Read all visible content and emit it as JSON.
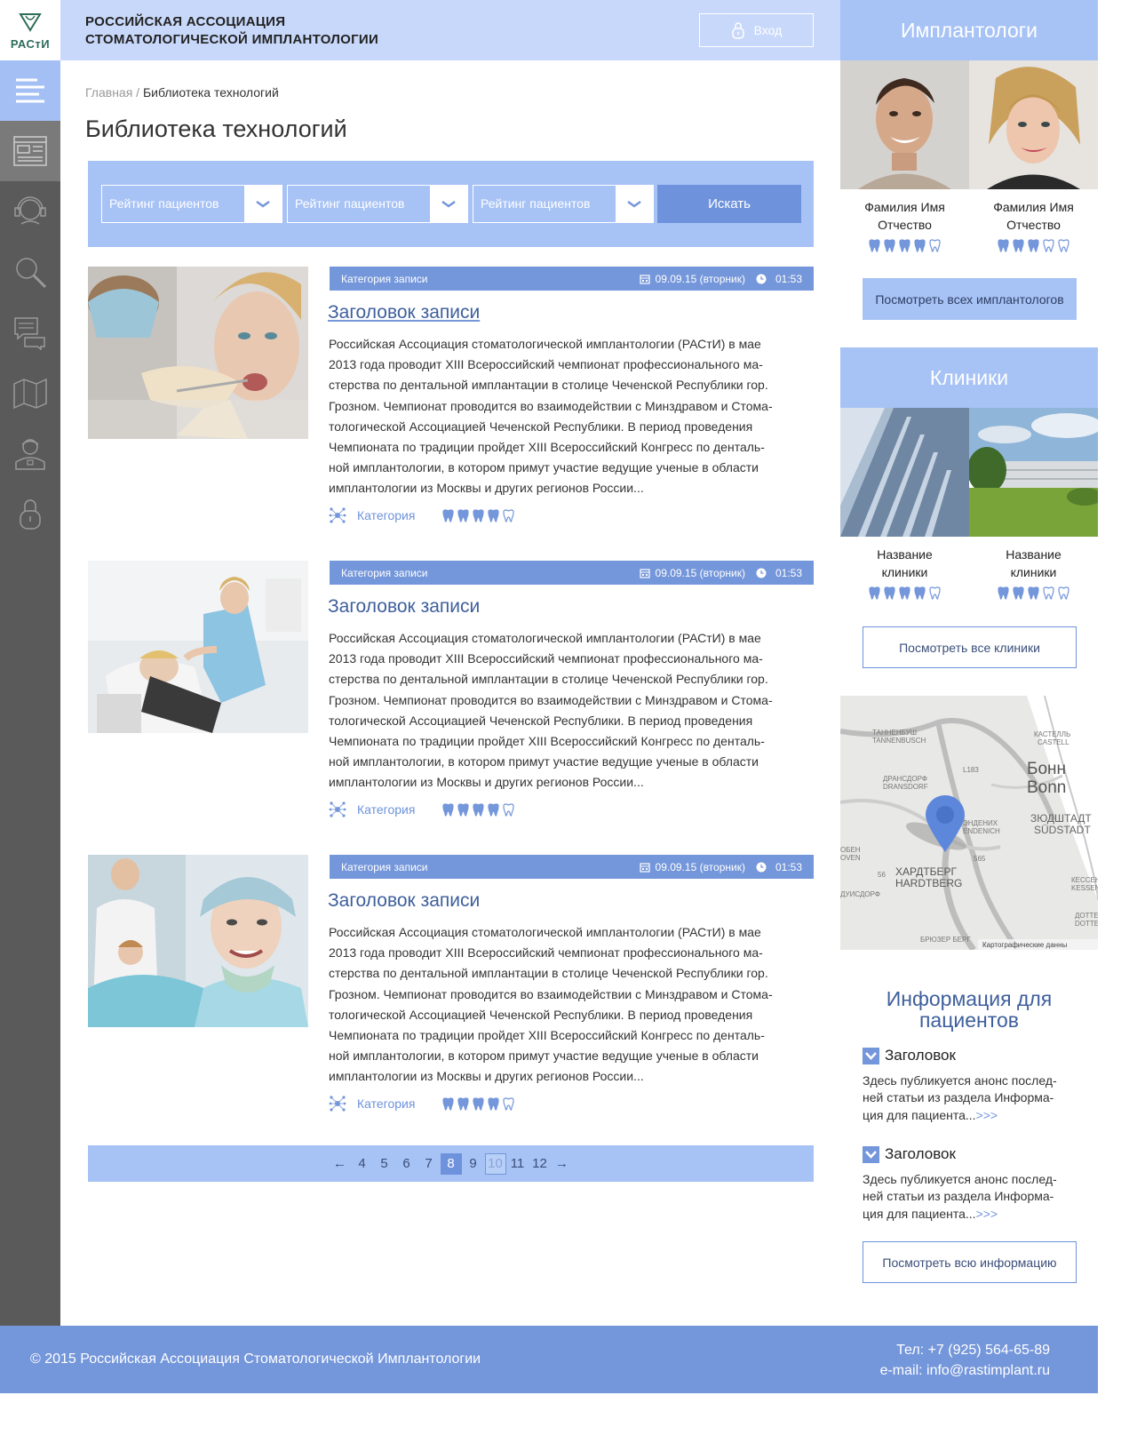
{
  "header": {
    "logo_text": "РАСтИ",
    "org_line1": "Российская Ассоциация",
    "org_line2": "Стоматологической Имплантологии",
    "login_label": "Вход"
  },
  "sidebar": {
    "items": [
      "menu-icon",
      "library-icon",
      "support-icon",
      "search-icon",
      "chat-icon",
      "map-icon",
      "doctor-icon",
      "lock-icon"
    ]
  },
  "breadcrumb": {
    "home": "Главная",
    "sep": " / ",
    "current": "Библиотека технологий"
  },
  "page_title": "Библиотека технологий",
  "filters": {
    "select1": "Рейтинг пациентов",
    "select2": "Рейтинг пациентов",
    "select3": "Рейтинг пациентов",
    "search_label": "Искать"
  },
  "posts": [
    {
      "category": "Категория записи",
      "date": "09.09.15 (вторник)",
      "time": "01:53",
      "title": "Заголовок записи",
      "lines": [
        "Российская Ассоциация стоматологической имплантологии (РАСтИ) в мае",
        "2013 года проводит XIII Всероссийский чемпионат профессионального ма-",
        "стерства по дентальной имплантации в столице Чеченской Республики гор.",
        "Грозном. Чемпионат проводится во взаимодействии с Минздравом и Стома-",
        "тологической Ассоциацией Чеченской Республики. В период проведения",
        "Чемпионата по традиции пройдет XIII Всероссийский Конгресс по денталь-",
        "ной имплантологии, в котором примут участие ведущие ученые в области",
        "имплантологии из Москвы и других регионов России..."
      ],
      "tag": "Категория",
      "rating": 4
    },
    {
      "category": "Категория записи",
      "date": "09.09.15 (вторник)",
      "time": "01:53",
      "title": "Заголовок записи",
      "lines": [
        "Российская Ассоциация стоматологической имплантологии (РАСтИ) в мае",
        "2013 года проводит XIII Всероссийский чемпионат профессионального ма-",
        "стерства по дентальной имплантации в столице Чеченской Республики гор.",
        "Грозном. Чемпионат проводится во взаимодействии с Минздравом и Стома-",
        "тологической Ассоциацией Чеченской Республики. В период проведения",
        "Чемпионата по традиции пройдет XIII Всероссийский Конгресс по денталь-",
        "ной имплантологии, в котором примут участие ведущие ученые в области",
        "имплантологии из Москвы и других регионов России..."
      ],
      "tag": "Категория",
      "rating": 4
    },
    {
      "category": "Категория записи",
      "date": "09.09.15 (вторник)",
      "time": "01:53",
      "title": "Заголовок записи",
      "lines": [
        "Российская Ассоциация стоматологической имплантологии (РАСтИ) в мае",
        "2013 года проводит XIII Всероссийский чемпионат профессионального ма-",
        "стерства по дентальной имплантации в столице Чеченской Республики гор.",
        "Грозном. Чемпионат проводится во взаимодействии с Минздравом и Стома-",
        "тологической Ассоциацией Чеченской Республики. В период проведения",
        "Чемпионата по традиции пройдет XIII Всероссийский Конгресс по денталь-",
        "ной имплантологии, в котором примут участие ведущие ученые в области",
        "имплантологии из Москвы и других регионов России..."
      ],
      "tag": "Категория",
      "rating": 4
    }
  ],
  "pagination": {
    "prev": "←",
    "pages": [
      "4",
      "5",
      "6",
      "7",
      "8",
      "9",
      "10",
      "11",
      "12"
    ],
    "active": "8",
    "next": "→"
  },
  "implantologists": {
    "title": "Имплантологи",
    "people": [
      {
        "name1": "Фамилия Имя",
        "name2": "Отчество",
        "rating": 4
      },
      {
        "name1": "Фамилия Имя",
        "name2": "Отчество",
        "rating": 3
      }
    ],
    "button": "Посмотреть всех имплантологов"
  },
  "clinics": {
    "title": "Клиники",
    "items": [
      {
        "name1": "Название",
        "name2": "клиники",
        "rating": 4
      },
      {
        "name1": "Название",
        "name2": "клиники",
        "rating": 3
      }
    ],
    "button": "Посмотреть все клиники"
  },
  "map": {
    "labels": {
      "bonn_ru": "Бонн",
      "bonn_de": "Bonn",
      "tannenbusch_ru": "ТАННЕНБУШ",
      "tannenbusch_de": "TANNENBUSCH",
      "kastell_ru": "КАСТЕЛЛЬ",
      "kastell_de": "CASTELL",
      "dransdorf_ru": "ДРАНСДОРФ",
      "dransdorf_de": "DRANSDORF",
      "endenich_ru": "ЭНДЕНИХ",
      "endenich_de": "ENDENICH",
      "sudstadt_ru": "ЗЮДШТАДТ",
      "sudstadt_de": "SÜDSTADT",
      "hardtberg_ru": "ХАРДТБЕРГ",
      "hardtberg_de": "HARDTBERG",
      "duisdorf": "ДУИСДОРФ",
      "kessenich_ru": "КЕССЕНИХ",
      "kessenich_de": "KESSENICH",
      "dottendorf_ru": "ДОТТЕНДОРФ",
      "dottendorf_de": "DOTTEND",
      "brueser": "БРЮЗЕР БЕРГ",
      "copyright": "Картографические данны",
      "road1": "L183",
      "road2": "565",
      "road3": "56",
      "oben_ru": "ОБЕН",
      "oben_de": "OVEN"
    }
  },
  "patient_info": {
    "title": "Информация для пациентов",
    "items": [
      {
        "head": "Заголовок",
        "line1": "Здесь публикуется анонс послед-",
        "line2": "ней статьи из раздела Информа-",
        "line3": "ция для пациента...",
        "more": ">>>"
      },
      {
        "head": "Заголовок",
        "line1": "Здесь публикуется анонс послед-",
        "line2": "ней статьи из раздела Информа-",
        "line3": "ция для пациента...",
        "more": ">>>"
      }
    ],
    "button": "Посмотреть всю информацию"
  },
  "footer": {
    "copyright": "© 2015 Российская Ассоциация Стоматологической Имплантологии",
    "phone": "Тел: +7 (925) 564-65-89",
    "email": "e-mail: info@rastimplant.ru"
  },
  "colors": {
    "accent": "#7496da",
    "light": "#a7c2f5",
    "header_bg": "#c8d8fa",
    "sidebar": "#5a5a5a"
  }
}
